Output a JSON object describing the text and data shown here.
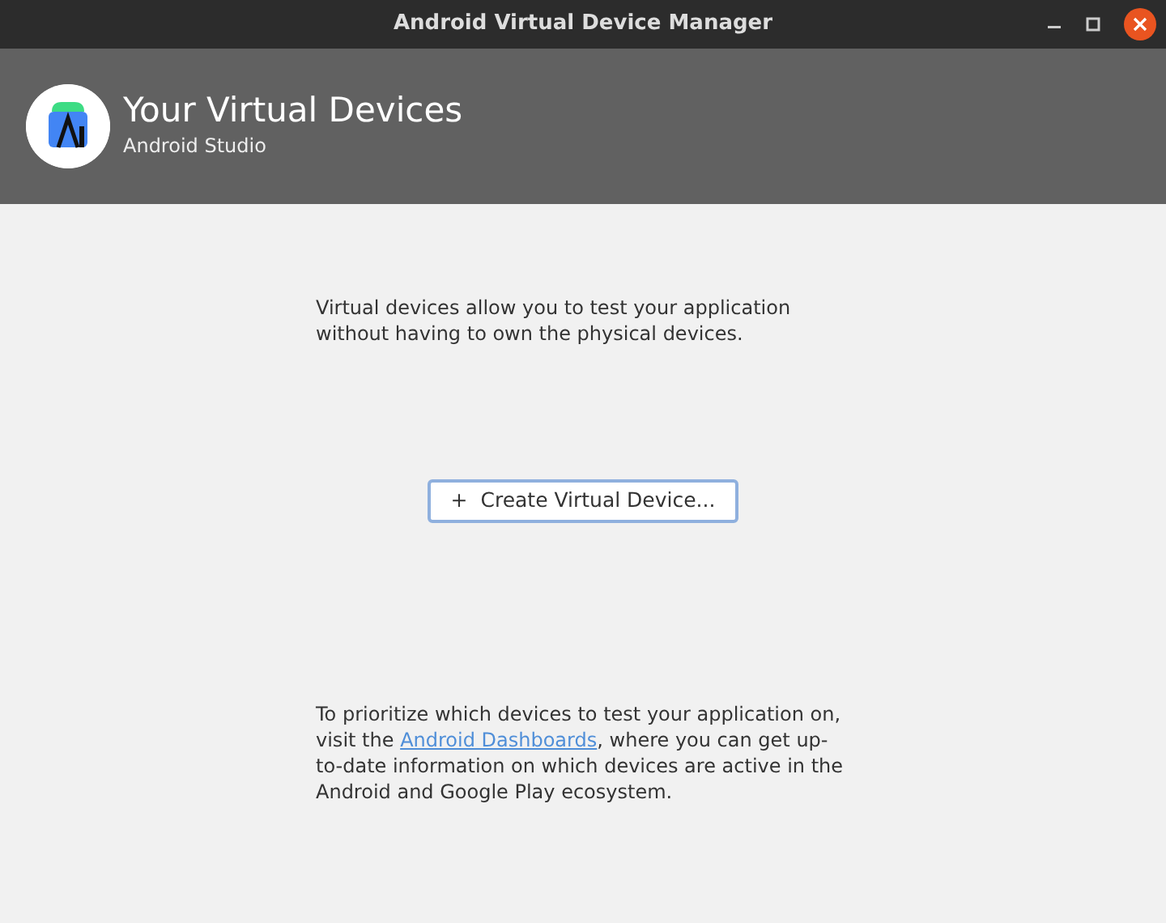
{
  "window": {
    "title": "Android Virtual Device Manager"
  },
  "header": {
    "title": "Your Virtual Devices",
    "subtitle": "Android Studio"
  },
  "intro": {
    "lines": [
      "Virtual devices allow you to test your application",
      "without having to own the physical devices."
    ]
  },
  "create_button": {
    "icon": "+",
    "label": "Create Virtual Device..."
  },
  "footer_note": {
    "before": "To prioritize which devices to test your application on, visit the ",
    "link": "Android Dashboards",
    "after": ", where you can get up-to-date information on which devices are active in the Android and Google Play ecosystem."
  }
}
